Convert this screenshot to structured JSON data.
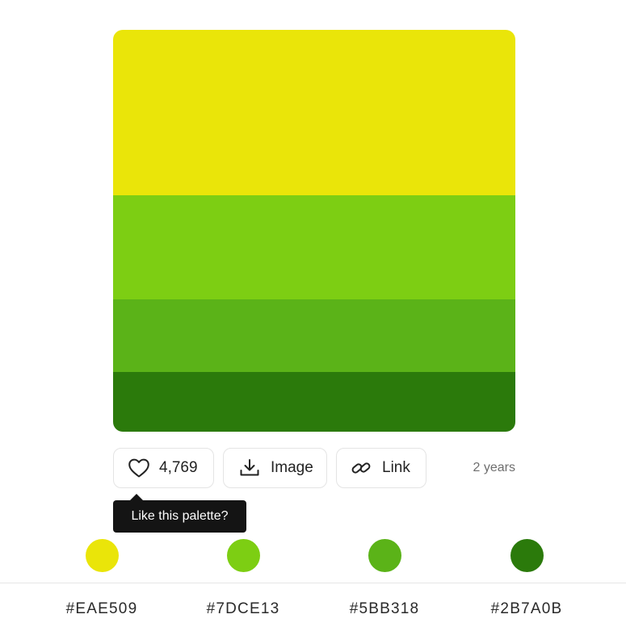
{
  "palette": {
    "colors": [
      {
        "hex": "#EAE509",
        "label": "#EAE509"
      },
      {
        "hex": "#7DCE13",
        "label": "#7DCE13"
      },
      {
        "hex": "#5BB318",
        "label": "#5BB318"
      },
      {
        "hex": "#2B7A0B",
        "label": "#2B7A0B"
      }
    ]
  },
  "actions": {
    "like": {
      "icon": "heart-icon",
      "label": "4,769"
    },
    "image": {
      "icon": "download-icon",
      "label": "Image"
    },
    "link": {
      "icon": "link-icon",
      "label": "Link"
    },
    "age": "2 years"
  },
  "tooltip": {
    "text": "Like this palette?"
  }
}
